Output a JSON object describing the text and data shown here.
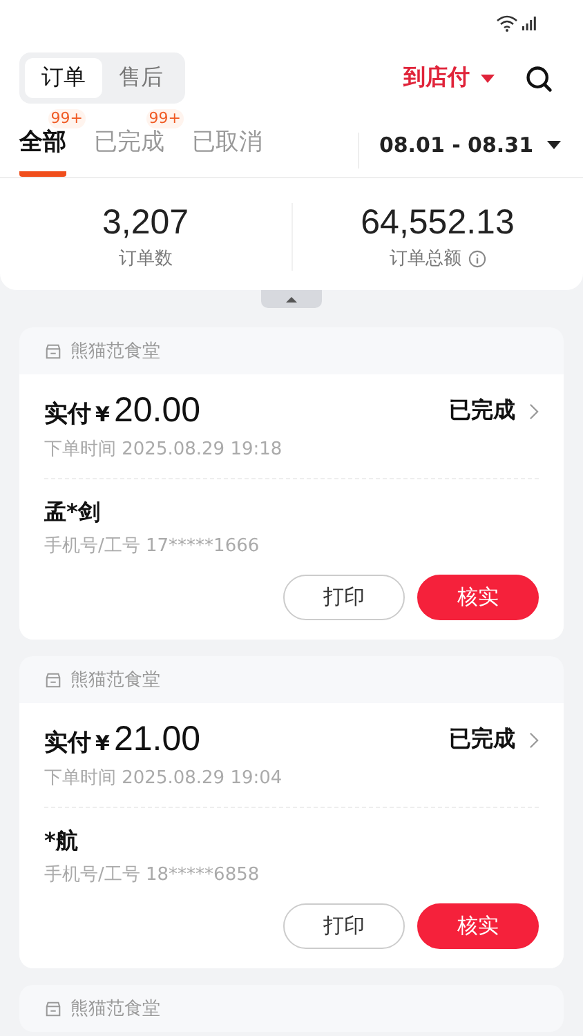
{
  "segments": [
    {
      "label": "订单",
      "selected": true
    },
    {
      "label": "售后",
      "selected": false
    }
  ],
  "payment_filter": {
    "label": "到店付"
  },
  "tabs": [
    {
      "label": "全部",
      "selected": true
    },
    {
      "label": "已完成",
      "selected": false,
      "badge": "99+"
    },
    {
      "label": "已取消",
      "selected": false
    }
  ],
  "all_badge": "99+",
  "date_range": "08.01 - 08.31",
  "stats": [
    {
      "value": "3,207",
      "label": "订单数",
      "info": false
    },
    {
      "value": "64,552.13",
      "label": "订单总额",
      "info": true
    }
  ],
  "orders": [
    {
      "store": "熊猫范食堂",
      "paid_label": "实付",
      "currency": "¥",
      "amount": "20.00",
      "status": "已完成",
      "time": "下单时间 2025.08.29 19:18",
      "name": "孟*剑",
      "phone": "手机号/工号 17*****1666",
      "buttons": [
        "打印",
        "核实"
      ]
    },
    {
      "store": "熊猫范食堂",
      "paid_label": "实付",
      "currency": "¥",
      "amount": "21.00",
      "status": "已完成",
      "time": "下单时间 2025.08.29 19:04",
      "name": "*航",
      "phone": "手机号/工号 18*****6858",
      "buttons": [
        "打印",
        "核实"
      ]
    },
    {
      "store": "熊猫范食堂"
    }
  ]
}
